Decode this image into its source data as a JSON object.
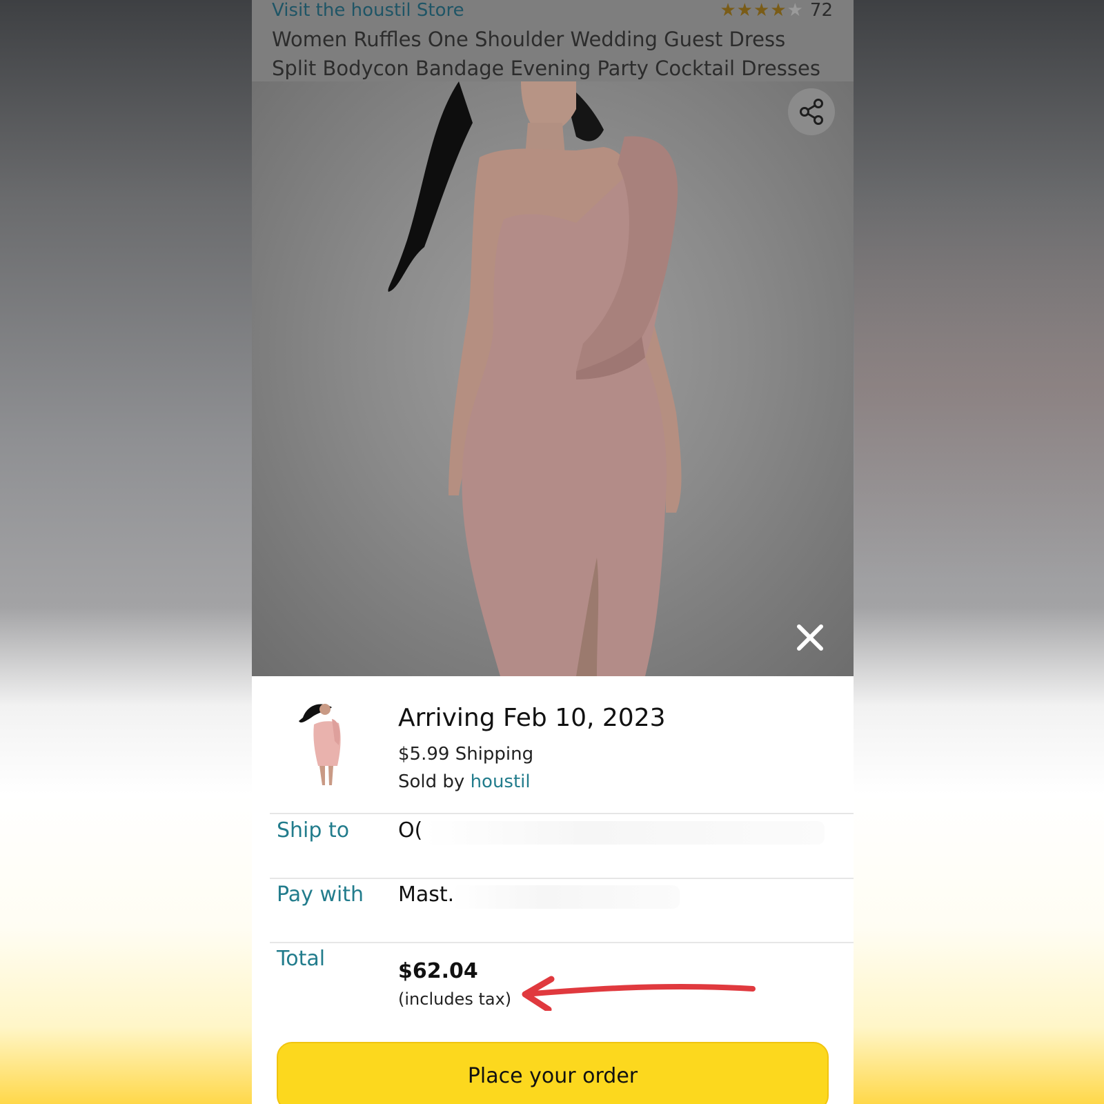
{
  "header": {
    "store_link": "Visit the houstil Store",
    "rating_stars": 4,
    "rating_max": 5,
    "review_count": "72",
    "product_title": "Women Ruffles One Shoulder Wedding Guest Dress Split Bodycon Bandage Evening Party Cocktail Dresses"
  },
  "image_viewer": {
    "share_icon": "share-icon",
    "close_icon": "close-icon"
  },
  "order": {
    "arriving": "Arriving Feb 10, 2023",
    "shipping": "$5.99 Shipping",
    "sold_by_prefix": "Sold by",
    "seller": "houstil",
    "ship_to_label": "Ship to",
    "ship_to_value": "O( ",
    "pay_with_label": "Pay with",
    "pay_with_value": "Mast. ",
    "total_label": "Total",
    "total_amount": "$62.04",
    "tax_note": "(includes tax)",
    "place_order_button": "Place your order"
  },
  "colors": {
    "link_teal": "#227c8c",
    "button_yellow": "#fcd81e",
    "annotation_red": "#e0393e"
  }
}
